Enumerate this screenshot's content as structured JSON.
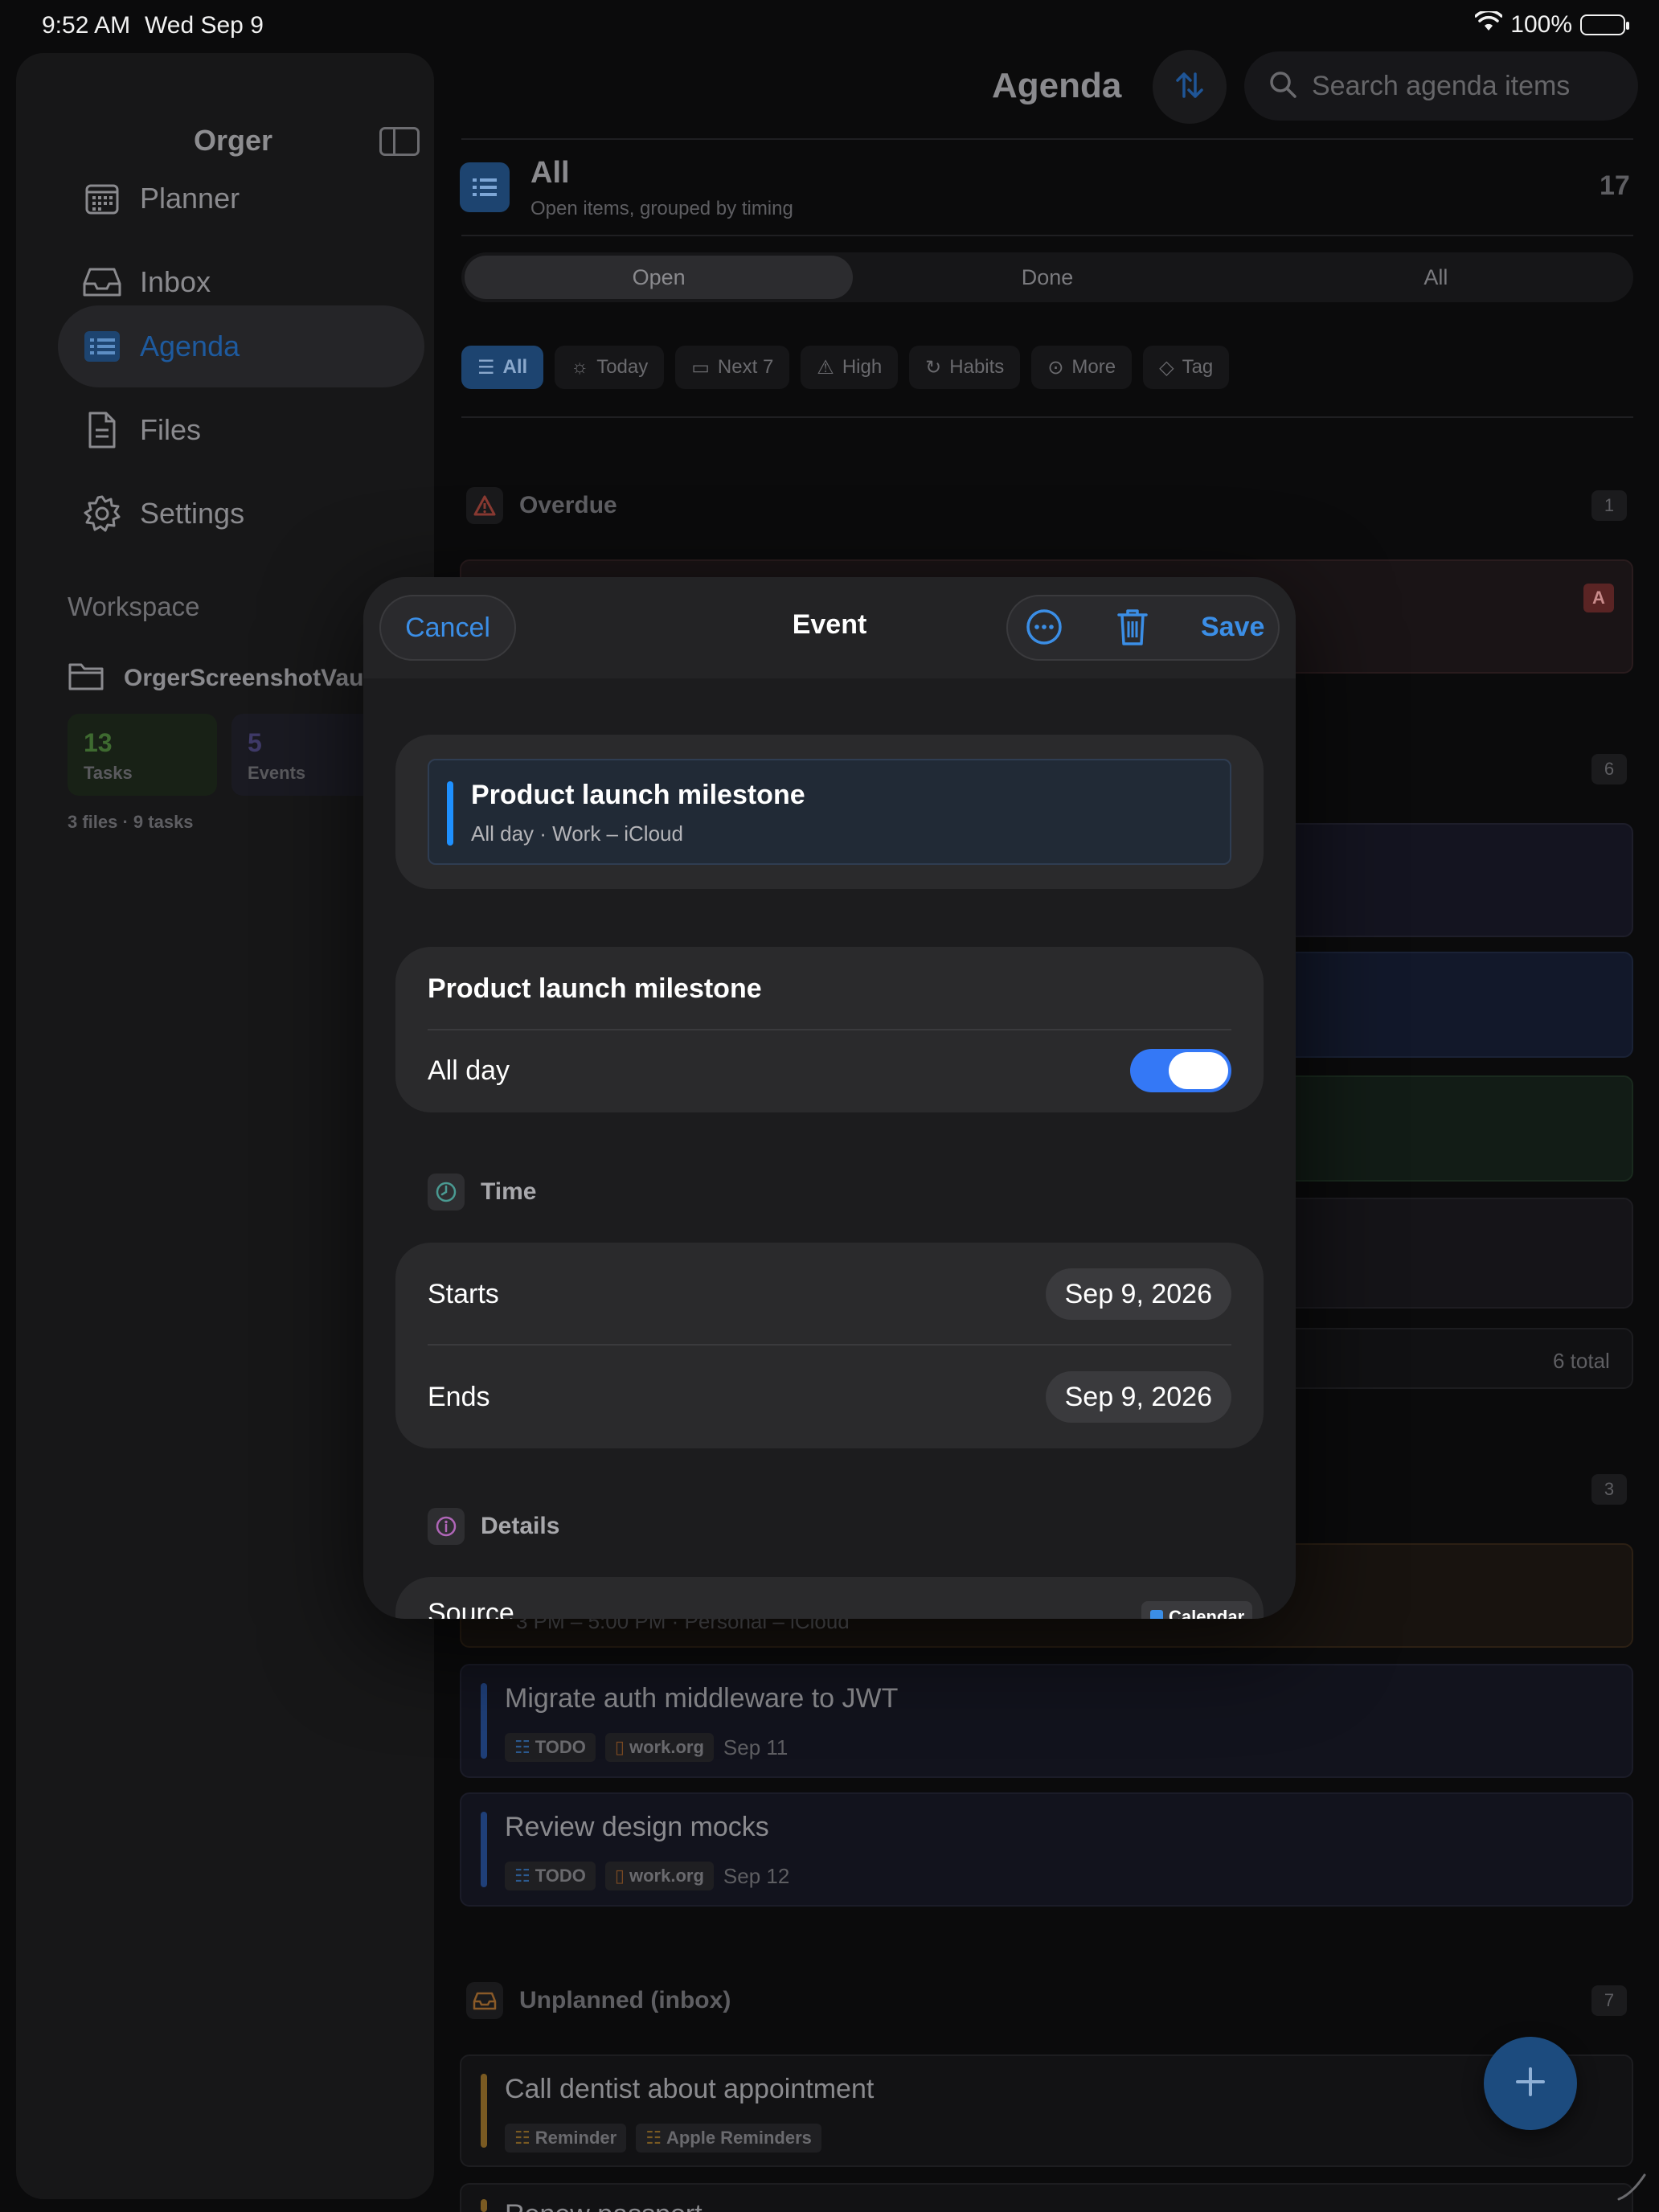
{
  "status_bar": {
    "time": "9:52 AM",
    "date": "Wed Sep 9",
    "battery": "100%"
  },
  "sidebar": {
    "title": "Orger",
    "items": [
      {
        "label": "Planner",
        "icon": "calendar-grid-icon"
      },
      {
        "label": "Inbox",
        "icon": "inbox-tray-icon"
      },
      {
        "label": "Agenda",
        "icon": "list-icon",
        "active": true
      },
      {
        "label": "Files",
        "icon": "document-icon"
      },
      {
        "label": "Settings",
        "icon": "gear-icon"
      }
    ],
    "workspace_label": "Workspace",
    "folder_name": "OrgerScreenshotVau",
    "stats": {
      "tasks_count": "13",
      "tasks_label": "Tasks",
      "events_count": "5",
      "events_label": "Events"
    },
    "summary": "3 files · 9 tasks"
  },
  "main": {
    "title": "Agenda",
    "search_placeholder": "Search agenda items",
    "list": {
      "title": "All",
      "subtitle": "Open items, grouped by timing",
      "count": "17"
    },
    "segments": [
      "Open",
      "Done",
      "All"
    ],
    "chips": [
      "All",
      "Today",
      "Next 7",
      "High",
      "Habits",
      "More",
      "Tag"
    ],
    "sections": {
      "overdue": {
        "label": "Overdue",
        "count": "1",
        "priority_badge": "A"
      },
      "section2_count": "6",
      "section2_total": "6 total",
      "section3_count": "3",
      "partial_meta": "3 PM – 5:00 PM · Personal – iCloud",
      "unplanned": {
        "label": "Unplanned (inbox)",
        "count": "7"
      }
    },
    "cards": [
      {
        "title": "Migrate auth middleware to JWT",
        "type": "TODO",
        "file": "work.org",
        "date": "Sep 11"
      },
      {
        "title": "Review design mocks",
        "type": "TODO",
        "file": "work.org",
        "date": "Sep 12"
      },
      {
        "title": "Call dentist about appointment",
        "type": "Reminder",
        "file": "Apple Reminders",
        "date": ""
      },
      {
        "title": "Renew passport",
        "type": "",
        "file": "",
        "date": ""
      }
    ]
  },
  "modal": {
    "cancel": "Cancel",
    "title": "Event",
    "save": "Save",
    "preview": {
      "title": "Product launch milestone",
      "subtitle": "All day · Work – iCloud"
    },
    "name_value": "Product launch milestone",
    "all_day_label": "All day",
    "all_day_on": true,
    "time_section": "Time",
    "starts_label": "Starts",
    "starts_value": "Sep 9, 2026",
    "ends_label": "Ends",
    "ends_value": "Sep 9, 2026",
    "details_section": "Details",
    "source_label": "Source",
    "source_value": "Calendar"
  },
  "colors": {
    "accent": "#3b8ee6",
    "toggle_on": "#3478f6",
    "event_bar": "#1e90ff"
  }
}
